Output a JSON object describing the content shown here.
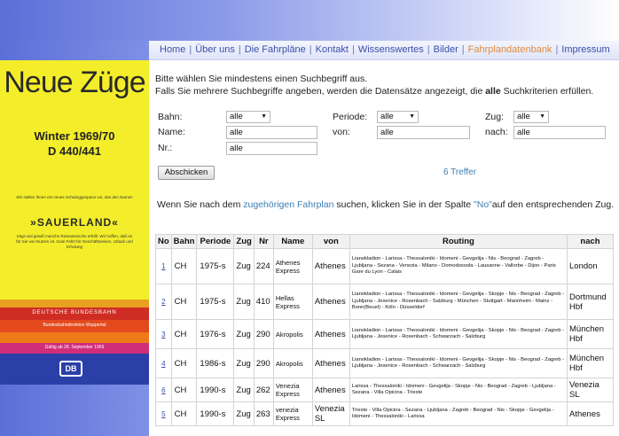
{
  "nav": {
    "items": [
      {
        "label": "Home",
        "active": false
      },
      {
        "label": "Über uns",
        "active": false
      },
      {
        "label": "Die Fahrpläne",
        "active": false
      },
      {
        "label": "Kontakt",
        "active": false
      },
      {
        "label": "Wissenswertes",
        "active": false
      },
      {
        "label": "Bilder",
        "active": false
      },
      {
        "label": "Fahrplandatenbank",
        "active": true
      },
      {
        "label": "Impressum",
        "active": false
      }
    ],
    "separator": "|"
  },
  "poster": {
    "title": "Neue Züge",
    "season": "Winter 1969/70",
    "train": "D 440/441",
    "small_text_1": "Wir stellen Ihnen ein neues Schwinggespann vor, das den Namen",
    "name": "»SAUERLAND«",
    "small_text_2": "trägt und gewiß manche Reisewünsche erfüllt. Wir hoffen, daß es für Sie von Nutzen ist. Gute Fahrt für Geschäftsreisen, Urlaub und Erholung",
    "db_line_1": "DEUTSCHE BUNDESBAHN",
    "db_line_2": "Bundesbahndirektion Wuppertal",
    "valid": "Gültig ab 28. September 1969",
    "logo": "DB"
  },
  "intro": {
    "line1": "Bitte wählen Sie mindestens einen Suchbegriff aus.",
    "line2_pre": "Falls Sie mehrere Suchbegriffe angeben, werden die Datensätze angezeigt, die ",
    "line2_bold": "alle",
    "line2_post": " Suchkriterien erfüllen."
  },
  "form": {
    "bahn_label": "Bahn:",
    "bahn_value": "alle",
    "periode_label": "Periode:",
    "periode_value": "alle",
    "zug_label": "Zug:",
    "zug_value": "alle",
    "name_label": "Name:",
    "name_value": "alle",
    "von_label": "von:",
    "von_value": "alle",
    "nach_label": "nach:",
    "nach_value": "alle",
    "nr_label": "Nr.:",
    "nr_value": "alle",
    "submit_label": "Abschicken",
    "hits": "6 Treffer"
  },
  "hint": {
    "pre": "Wenn Sie nach dem ",
    "link": "zugehörigen Fahrplan",
    "mid": " suchen, klicken Sie in der Spalte ",
    "col": "\"No\"",
    "post": "auf den entsprechenden Zug."
  },
  "table": {
    "headers": [
      "No",
      "Bahn",
      "Periode",
      "Zug",
      "Nr",
      "Name",
      "von",
      "Routing",
      "nach"
    ],
    "rows": [
      {
        "no": "1",
        "bahn": "CH",
        "periode": "1975-s",
        "zug": "Zug",
        "nr": "224",
        "name": "Athenes Express",
        "von": "Athenes",
        "routing": "Lianokladion - Larissa - Thessaloniki - Idomeni - Gevgelija - Nis - Beograd - Zagreb - Ljubljana - Sezana - Venezia - Milano - Domodossola - Lausanne - Vallorbe - Dijon - Paris Gare du Lyon - Calais",
        "nach": "London"
      },
      {
        "no": "2",
        "bahn": "CH",
        "periode": "1975-s",
        "zug": "Zug",
        "nr": "410",
        "name": "Hellas Express",
        "von": "Athenes",
        "routing": "Lianokladion - Larissa - Thessaloniki - Idomeni - Gevgelija - Skopje - Nis - Beograd - Zagreb - Ljubljana - Jesenice - Rosenbach - Salzburg - München - Stuttgart - Mannheim - Mainz - Bonn(Beuel) - Köln - Düsseldorf",
        "nach": "Dortmund Hbf"
      },
      {
        "no": "3",
        "bahn": "CH",
        "periode": "1976-s",
        "zug": "Zug",
        "nr": "290",
        "name": "Akropolis",
        "von": "Athenes",
        "routing": "Lianokladion - Larissa - Thessaloniki - Idomeni - Gevgelija - Skopje - Nis - Beograd - Zagreb - Ljubljana - Jesenice - Rosenbach - Schwarzach - Salzburg",
        "nach": "München Hbf"
      },
      {
        "no": "4",
        "bahn": "CH",
        "periode": "1986-s",
        "zug": "Zug",
        "nr": "290",
        "name": "Akropolis",
        "von": "Athenes",
        "routing": "Lianokladion - Larissa - Thessaloniki - Idomeni - Gevgelija - Skopje - Nis - Beograd - Zagreb - Ljubljana - Jesenice - Rosenbach - Schwarzach - Salzburg",
        "nach": "München Hbf"
      },
      {
        "no": "6",
        "bahn": "CH",
        "periode": "1990-s",
        "zug": "Zug",
        "nr": "262",
        "name": "Venezia Express",
        "von": "Athenes",
        "routing": "Larissa - Thessaloniki - Idomeni - Gevgelija - Skopje - Nis - Beograd - Zagreb - Ljubljana - Sezana - Villa Opicina - Trieste",
        "nach": "Venezia SL"
      },
      {
        "no": "5",
        "bahn": "CH",
        "periode": "1990-s",
        "zug": "Zug",
        "nr": "263",
        "name": "venezia Express",
        "von": "Venezia SL",
        "routing": "Trieste - Villa Opicina - Sezana - Ljubljana - Zagreb - Beograd - Nis - Skopje - Gevgelija - Idomeni - Thessaloniki - Larissa",
        "nach": "Athenes"
      }
    ]
  },
  "colors": {
    "header_gradient_start": "#5b6fd8",
    "nav_text": "#3b4fa8",
    "nav_active": "#e08c3c",
    "link": "#3b7fb5",
    "poster_yellow": "#f4ee2a"
  }
}
